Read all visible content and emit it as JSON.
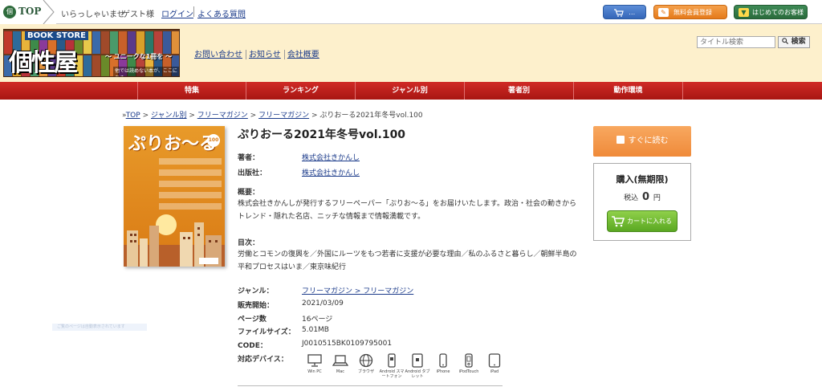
{
  "topbar": {
    "top_label": "TOP",
    "welcome": "いらっしゃいませ",
    "guest": "ゲスト様",
    "login": "ログイン",
    "faq": "よくある質問",
    "cart_label": "…",
    "register_label": "無料会員登録",
    "first_label": "はじめてのお客様へ"
  },
  "header": {
    "banner_top": "BOOK STORE",
    "banner_name": "個性屋",
    "banner_tag": "〜 ユニークな1冊を 〜",
    "banner_sub": "他では読めない本が、ここにある。",
    "links": [
      "お問い合わせ",
      "お知らせ",
      "会社概要"
    ],
    "search_placeholder": "タイトル検索",
    "search_button": "検索"
  },
  "nav": [
    "特集",
    "ランキング",
    "ジャンル別",
    "著者別",
    "動作環境"
  ],
  "breadcrumb": {
    "prefix": "»",
    "items": [
      "TOP",
      "ジャンル別",
      "フリーマガジン",
      "フリーマガジン"
    ],
    "current": "ぷりおーる2021年冬号vol.100"
  },
  "cover": {
    "title": "ぷりお〜る",
    "number": "100"
  },
  "book": {
    "title": "ぷりおーる2021年冬号vol.100",
    "author_label": "著者：",
    "author": "株式会社きかんし",
    "publisher_label": "出版社：",
    "publisher": "株式会社きかんし",
    "summary_label": "概要：",
    "summary": "株式会社きかんしが発行するフリーペーパー「ぷりお〜る」をお届けいたします。政治・社会の動きからトレンド・隠れた名店、ニッチな情報まで情報満載です。",
    "toc_label": "目次：",
    "toc": "労働とコモンの復興を／外国にルーツをもつ若者に支援が必要な理由／私のふるさと暮らし／朝鮮半島の平和プロセスはいま／東京味紀行",
    "genre_label": "ジャンル：",
    "genre": "フリーマガジン > フリーマガジン",
    "release_label": "販売開始：",
    "release": "2021/03/09",
    "pages_label": "ページ数",
    "pages": "16ページ",
    "size_label": "ファイルサイズ：",
    "size": "5.01MB",
    "code_label": "CODE：",
    "code": "J0010515BK0109795001",
    "devices_label": "対応デバイス：",
    "devices": [
      {
        "icon": "monitor-icon",
        "label": "Win PC"
      },
      {
        "icon": "laptop-icon",
        "label": "Mac"
      },
      {
        "icon": "globe-icon",
        "label": "ブラウザ"
      },
      {
        "icon": "android-phone-icon",
        "label": "Android スマートフォン"
      },
      {
        "icon": "android-tablet-icon",
        "label": "Android タブレット"
      },
      {
        "icon": "iphone-icon",
        "label": "iPhone"
      },
      {
        "icon": "ipod-icon",
        "label": "iPodTouch"
      },
      {
        "icon": "ipad-icon",
        "label": "iPad"
      }
    ]
  },
  "purchase": {
    "read_now": "すぐに読む",
    "box_title": "購入(無期限)",
    "tax_label": "税込",
    "price": "0",
    "currency": "円",
    "cart_button": "カートに入れる"
  },
  "side_hint": "ご覧のページは自動表示されています",
  "colors": {
    "nav_red": "#c0201c",
    "header_cream": "#fdf0cc",
    "read_orange": "#ef8a3a",
    "cart_green": "#5aa822"
  }
}
